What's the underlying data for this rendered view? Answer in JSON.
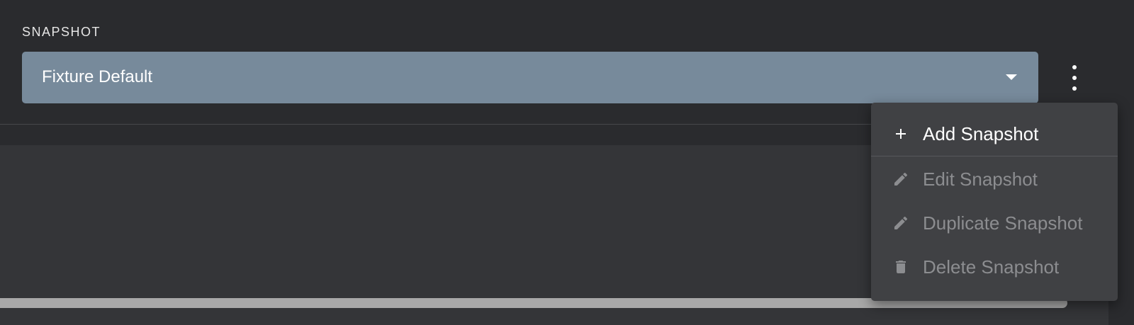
{
  "snapshot": {
    "section_label": "SNAPSHOT",
    "selected_value": "Fixture Default"
  },
  "menu": {
    "items": [
      {
        "label": "Add Snapshot",
        "icon": "plus-icon",
        "enabled": true
      },
      {
        "label": "Edit Snapshot",
        "icon": "pencil-icon",
        "enabled": false
      },
      {
        "label": "Duplicate Snapshot",
        "icon": "pencil-icon",
        "enabled": false
      },
      {
        "label": "Delete Snapshot",
        "icon": "trash-icon",
        "enabled": false
      }
    ]
  },
  "colors": {
    "background": "#2a2b2e",
    "select_fill": "#778a9b",
    "menu_fill": "#404144",
    "disabled_text": "#8c8d90"
  }
}
